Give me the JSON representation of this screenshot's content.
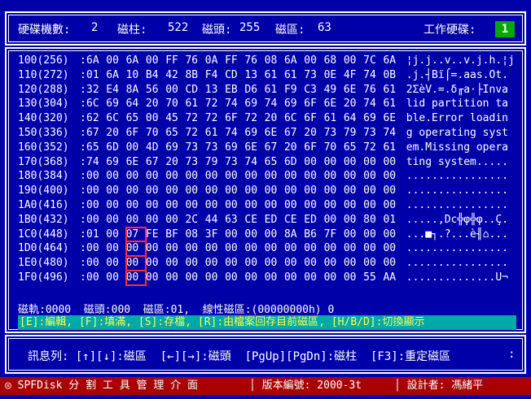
{
  "header": {
    "disk_count_label": "硬碟機數:",
    "disk_count": "2",
    "cylinder_label": "磁柱:",
    "cylinder": "522",
    "head_label": "磁頭:",
    "head": "255",
    "sector_label": "磁區:",
    "sector": "63",
    "work_disk_label": "工作硬碟:",
    "work_disk": "1"
  },
  "hex_rows": [
    {
      "offset": "100(256)",
      "bytes": [
        "6A",
        "00",
        "6A",
        "00",
        "FF",
        "76",
        "0A",
        "FF",
        "76",
        "08",
        "6A",
        "00",
        "68",
        "00",
        "7C",
        "6A"
      ],
      "ascii": "¦j.j..v..v.j.h.¦j"
    },
    {
      "offset": "110(272)",
      "bytes": [
        "01",
        "6A",
        "10",
        "B4",
        "42",
        "8B",
        "F4",
        "CD",
        "13",
        "61",
        "61",
        "73",
        "0E",
        "4F",
        "74",
        "0B"
      ],
      "ascii": ".j.┤Bï⌠=.aas.Ot."
    },
    {
      "offset": "120(288)",
      "bytes": [
        "32",
        "E4",
        "8A",
        "56",
        "00",
        "CD",
        "13",
        "EB",
        "D6",
        "61",
        "F9",
        "C3",
        "49",
        "6E",
        "76",
        "61"
      ],
      "ascii": "2ΣèV.=.δ╓a·├Inva"
    },
    {
      "offset": "130(304)",
      "bytes": [
        "6C",
        "69",
        "64",
        "20",
        "70",
        "61",
        "72",
        "74",
        "69",
        "74",
        "69",
        "6F",
        "6E",
        "20",
        "74",
        "61"
      ],
      "ascii": "lid partition ta"
    },
    {
      "offset": "140(320)",
      "bytes": [
        "62",
        "6C",
        "65",
        "00",
        "45",
        "72",
        "72",
        "6F",
        "72",
        "20",
        "6C",
        "6F",
        "61",
        "64",
        "69",
        "6E"
      ],
      "ascii": "ble.Error loadin"
    },
    {
      "offset": "150(336)",
      "bytes": [
        "67",
        "20",
        "6F",
        "70",
        "65",
        "72",
        "61",
        "74",
        "69",
        "6E",
        "67",
        "20",
        "73",
        "79",
        "73",
        "74"
      ],
      "ascii": "g operating syst"
    },
    {
      "offset": "160(352)",
      "bytes": [
        "65",
        "6D",
        "00",
        "4D",
        "69",
        "73",
        "73",
        "69",
        "6E",
        "67",
        "20",
        "6F",
        "70",
        "65",
        "72",
        "61"
      ],
      "ascii": "em.Missing opera"
    },
    {
      "offset": "170(368)",
      "bytes": [
        "74",
        "69",
        "6E",
        "67",
        "20",
        "73",
        "79",
        "73",
        "74",
        "65",
        "6D",
        "00",
        "00",
        "00",
        "00",
        "00"
      ],
      "ascii": "ting system....."
    },
    {
      "offset": "180(384)",
      "bytes": [
        "00",
        "00",
        "00",
        "00",
        "00",
        "00",
        "00",
        "00",
        "00",
        "00",
        "00",
        "00",
        "00",
        "00",
        "00",
        "00"
      ],
      "ascii": "................"
    },
    {
      "offset": "190(400)",
      "bytes": [
        "00",
        "00",
        "00",
        "00",
        "00",
        "00",
        "00",
        "00",
        "00",
        "00",
        "00",
        "00",
        "00",
        "00",
        "00",
        "00"
      ],
      "ascii": "................"
    },
    {
      "offset": "1A0(416)",
      "bytes": [
        "00",
        "00",
        "00",
        "00",
        "00",
        "00",
        "00",
        "00",
        "00",
        "00",
        "00",
        "00",
        "00",
        "00",
        "00",
        "00"
      ],
      "ascii": "................"
    },
    {
      "offset": "1B0(432)",
      "bytes": [
        "00",
        "00",
        "00",
        "00",
        "00",
        "2C",
        "44",
        "63",
        "CE",
        "ED",
        "CE",
        "ED",
        "00",
        "00",
        "80",
        "01"
      ],
      "ascii": ".....,Dc╬φ╬φ..Ç."
    },
    {
      "offset": "1C0(448)",
      "bytes": [
        "01",
        "00",
        "07",
        "FE",
        "BF",
        "08",
        "3F",
        "00",
        "00",
        "00",
        "8A",
        "B6",
        "7F",
        "00",
        "00",
        "00"
      ],
      "ascii": "...■┐.?...è╢⌂..."
    },
    {
      "offset": "1D0(464)",
      "bytes": [
        "00",
        "00",
        "00",
        "00",
        "00",
        "00",
        "00",
        "00",
        "00",
        "00",
        "00",
        "00",
        "00",
        "00",
        "00",
        "00"
      ],
      "ascii": "................"
    },
    {
      "offset": "1E0(480)",
      "bytes": [
        "00",
        "00",
        "00",
        "00",
        "00",
        "00",
        "00",
        "00",
        "00",
        "00",
        "00",
        "00",
        "00",
        "00",
        "00",
        "00"
      ],
      "ascii": "................"
    },
    {
      "offset": "1F0(496)",
      "bytes": [
        "00",
        "00",
        "00",
        "00",
        "00",
        "00",
        "00",
        "00",
        "00",
        "00",
        "00",
        "00",
        "00",
        "00",
        "55",
        "AA"
      ],
      "ascii": "..............U¬"
    }
  ],
  "status": {
    "text": "磁軌:0000  磁頭:000  磁區:01,  線性磁區:(00000000h) 0"
  },
  "commands": {
    "text": "[E]:編輯, [F]:填滿, [S]:存檔, [R]:由檔案回存目前磁區, [H/B/D]:切換顯示"
  },
  "help": {
    "text": "訊息列: [↑][↓]:磁區  [←][→]:磁頭  [PgUp][PgDn]:磁柱  [F3]:重定磁區",
    "end": ":"
  },
  "footer": {
    "title": "◎ SPFDisk 分 割 工 具 管 理 介 面",
    "version": "│ 版本編號: 2000-3t",
    "designer": "│ 設計者: 馮緒平"
  },
  "colors": {
    "background": "#0000a8",
    "command_bar": "#00a8a8",
    "footer": "#a80000",
    "work_disk_badge": "#00a800",
    "selection": "#ff3030"
  }
}
